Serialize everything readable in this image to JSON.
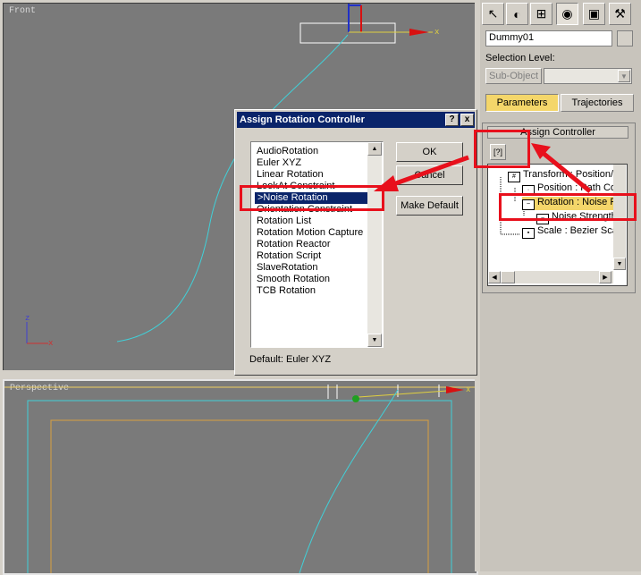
{
  "viewports": {
    "front_label": "Front",
    "perspective_label": "Perspective",
    "axis_x": "x",
    "axis_z": "z"
  },
  "command_panel": {
    "tabs": [
      "create-icon",
      "modify-icon",
      "hierarchy-icon",
      "motion-icon",
      "display-icon",
      "utilities-icon"
    ],
    "object_name": "Dummy01",
    "selection_level_label": "Selection Level:",
    "sub_object_label": "Sub-Object",
    "parameters_label": "Parameters",
    "trajectories_label": "Trajectories",
    "assign_controller_label": "Assign Controller",
    "tree": [
      {
        "label": "Transform : Position/"
      },
      {
        "label": "Position : Path Co"
      },
      {
        "label": "Rotation : Noise R"
      },
      {
        "label": "Noise Strength"
      },
      {
        "label": "Scale : Bezier Sca"
      }
    ]
  },
  "dialog": {
    "title": "Assign Rotation Controller",
    "help_btn": "?",
    "close_btn": "x",
    "items": [
      "AudioRotation",
      "Euler XYZ",
      "Linear Rotation",
      "LookAt Constraint",
      ">Noise Rotation",
      "Orientation Constraint",
      "Rotation List",
      "Rotation Motion Capture",
      "Rotation Reactor",
      "Rotation Script",
      "SlaveRotation",
      "Smooth Rotation",
      "TCB Rotation"
    ],
    "selected_index": 4,
    "ok_label": "OK",
    "cancel_label": "Cancel",
    "make_default_label": "Make Default",
    "default_label": "Default:",
    "default_value": "Euler XYZ"
  },
  "colors": {
    "annotation": "#e8101c",
    "selection": "#0a246a",
    "highlight": "#f4d66a",
    "viewport_bg": "#7a7a7a"
  }
}
